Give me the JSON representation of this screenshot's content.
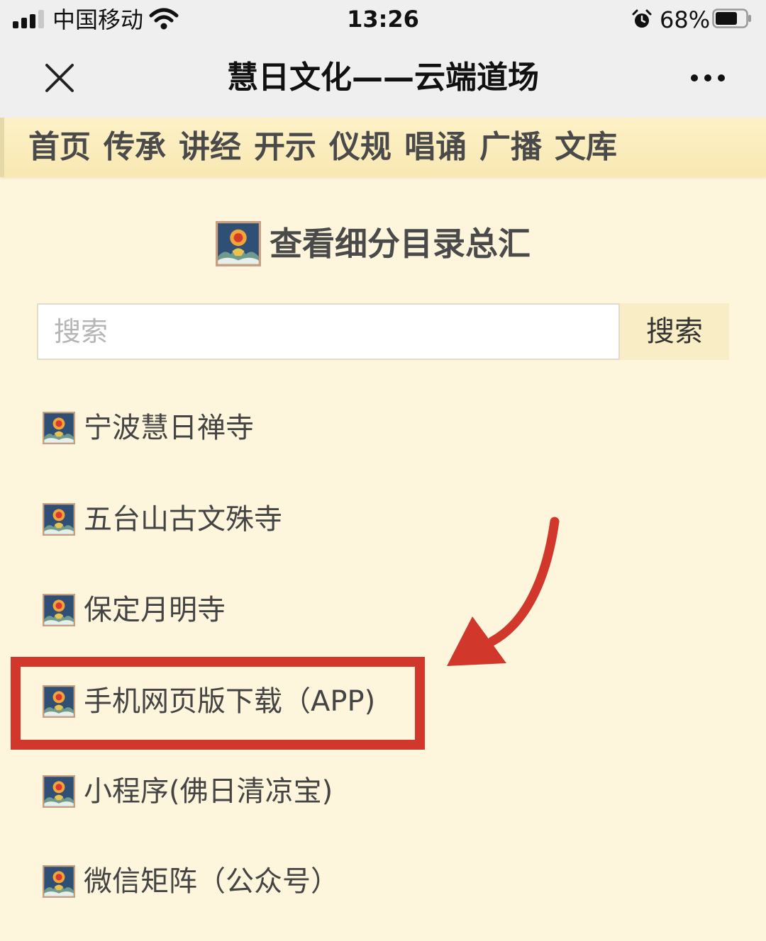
{
  "status_bar": {
    "carrier": "中国移动",
    "time": "13:26",
    "battery": "68%"
  },
  "title_bar": {
    "title": "慧日文化——云端道场",
    "icons": [
      "close-icon",
      "more-icon"
    ]
  },
  "nav": {
    "items": [
      "首页",
      "传承",
      "讲经",
      "开示",
      "仪规",
      "唱诵",
      "广播",
      "文库"
    ]
  },
  "main": {
    "heading": "查看细分目录总汇",
    "search": {
      "placeholder": "搜索",
      "button_label": "搜索"
    },
    "list": [
      {
        "label": "宁波慧日禅寺"
      },
      {
        "label": "五台山古文殊寺"
      },
      {
        "label": "保定月明寺"
      },
      {
        "label": "手机网页版下载（APP)"
      },
      {
        "label": "小程序(佛日清凉宝)"
      },
      {
        "label": "微信矩阵（公众号）"
      }
    ]
  },
  "colors": {
    "page_background": "#fdf6dc",
    "nav_background": "#f8e8b2",
    "annotation_red": "#d2372c"
  }
}
